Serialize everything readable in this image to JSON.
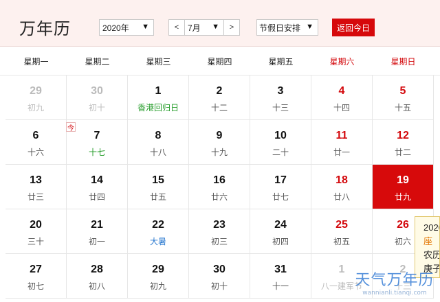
{
  "header": {
    "title": "万年历",
    "year_value": "2020年",
    "month_value": "7月",
    "month_prev": "<",
    "month_next": ">",
    "holiday_value": "节假日安排",
    "caret": "▼",
    "today_button": "返回今日"
  },
  "weekdays": [
    "星期一",
    "星期二",
    "星期三",
    "星期四",
    "星期五",
    "星期六",
    "星期日"
  ],
  "today_mark": "今",
  "calendar": [
    {
      "day": "29",
      "lunar": "初九"
    },
    {
      "day": "30",
      "lunar": "初十"
    },
    {
      "day": "1",
      "lunar": "香港回归日"
    },
    {
      "day": "2",
      "lunar": "十二"
    },
    {
      "day": "3",
      "lunar": "十三"
    },
    {
      "day": "4",
      "lunar": "十四"
    },
    {
      "day": "5",
      "lunar": "十五"
    },
    {
      "day": "6",
      "lunar": "十六"
    },
    {
      "day": "7",
      "lunar": "十七"
    },
    {
      "day": "8",
      "lunar": "十八"
    },
    {
      "day": "9",
      "lunar": "十九"
    },
    {
      "day": "10",
      "lunar": "二十"
    },
    {
      "day": "11",
      "lunar": "廿一"
    },
    {
      "day": "12",
      "lunar": "廿二"
    },
    {
      "day": "13",
      "lunar": "廿三"
    },
    {
      "day": "14",
      "lunar": "廿四"
    },
    {
      "day": "15",
      "lunar": "廿五"
    },
    {
      "day": "16",
      "lunar": "廿六"
    },
    {
      "day": "17",
      "lunar": "廿七"
    },
    {
      "day": "18",
      "lunar": "廿八"
    },
    {
      "day": "19",
      "lunar": "廿九"
    },
    {
      "day": "20",
      "lunar": "三十"
    },
    {
      "day": "21",
      "lunar": "初一"
    },
    {
      "day": "22",
      "lunar": "大暑"
    },
    {
      "day": "23",
      "lunar": "初三"
    },
    {
      "day": "24",
      "lunar": "初四"
    },
    {
      "day": "25",
      "lunar": "初五"
    },
    {
      "day": "26",
      "lunar": "初六"
    },
    {
      "day": "27",
      "lunar": "初七"
    },
    {
      "day": "28",
      "lunar": "初八"
    },
    {
      "day": "29",
      "lunar": "初九"
    },
    {
      "day": "30",
      "lunar": "初十"
    },
    {
      "day": "31",
      "lunar": "十一"
    },
    {
      "day": "1",
      "lunar": "八一建军节"
    },
    {
      "day": "2",
      "lunar": "十三"
    }
  ],
  "tooltip": {
    "line1": "2020",
    "line2": "座",
    "line3": "农历",
    "line4": "庚子"
  },
  "watermark": {
    "brand": "天气万年历",
    "url": "wannianli.tianqi.com"
  },
  "colors": {
    "accent_red": "#d6090b",
    "header_bg": "#fdf1ef",
    "festival_green": "#259c2a",
    "solar_term_blue": "#2e7bd0"
  }
}
